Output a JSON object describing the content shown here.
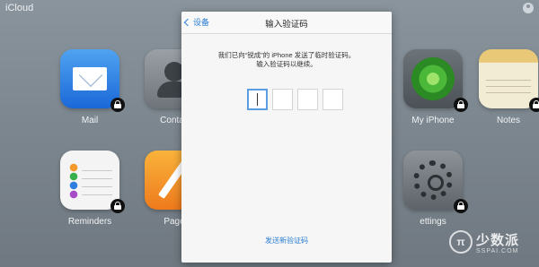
{
  "topbar": {
    "brand": "iCloud",
    "user_icon": "user-circle-icon"
  },
  "apps": [
    {
      "label": "Mail",
      "icon": "mail-icon",
      "locked": true
    },
    {
      "label": "Contac",
      "icon": "contacts-icon",
      "locked": true
    },
    {
      "label": "My iPhone",
      "icon": "find-iphone-radar-icon",
      "locked": true
    },
    {
      "label": "Notes",
      "icon": "notes-icon",
      "locked": true
    },
    {
      "label": "Reminders",
      "icon": "reminders-icon",
      "locked": true
    },
    {
      "label": "Page",
      "icon": "pages-icon",
      "locked": true
    },
    {
      "label": "ettings",
      "icon": "settings-gear-icon",
      "locked": true
    }
  ],
  "modal": {
    "back_label": "设备",
    "title": "输入验证码",
    "instruction_line1": "我们已向“锐成”的 iPhone 发送了临时验证码。",
    "instruction_line2": "输入验证码以继续。",
    "code_digits": [
      "",
      "",
      "",
      ""
    ],
    "resend_label": "发送新验证码"
  },
  "watermark": {
    "logo": "π",
    "name": "少数派",
    "sub": "SSPAI.COM"
  },
  "colors": {
    "accent": "#2a7fd4",
    "active_box_border": "#5b9de0"
  }
}
